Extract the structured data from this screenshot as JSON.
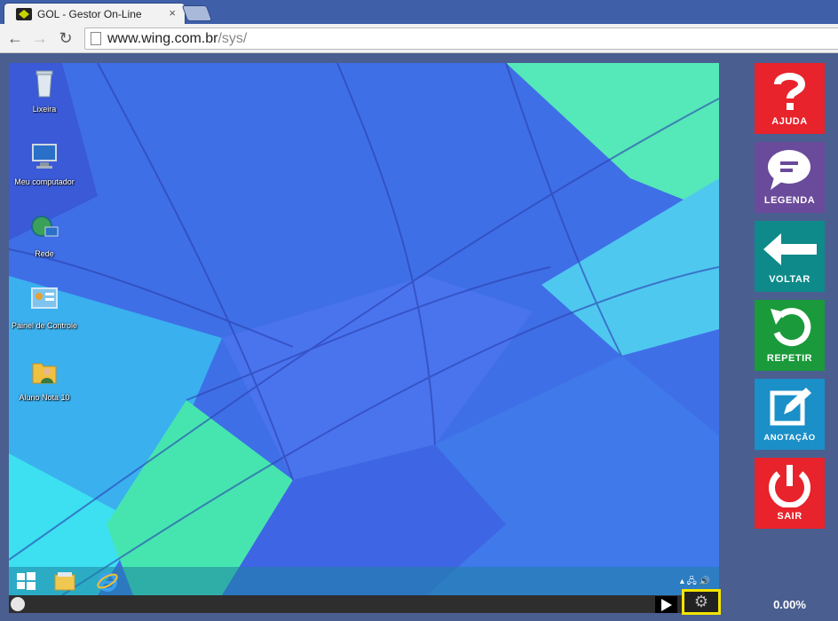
{
  "browser": {
    "tab_title": "GOL - Gestor On-Line",
    "close_glyph": "×",
    "url_host": "www.wing.com.br",
    "url_path": "/sys/",
    "back_glyph": "←",
    "forward_glyph": "→",
    "reload_glyph": "↻"
  },
  "desktop": {
    "icons": [
      {
        "label": "Lixeira",
        "icon": "recycle-bin-icon"
      },
      {
        "label": "Meu computador",
        "icon": "computer-icon"
      },
      {
        "label": "Rede",
        "icon": "network-icon"
      },
      {
        "label": "Painel de Controle",
        "icon": "control-panel-icon"
      },
      {
        "label": "Aluno Nota 10",
        "icon": "user-folder-icon"
      }
    ],
    "taskbar": {
      "items": [
        "start-icon",
        "file-explorer-icon",
        "internet-explorer-icon"
      ],
      "tray": "▴  🖧  🔊"
    }
  },
  "player": {
    "progress": "0.00%",
    "gear_glyph": "⚙"
  },
  "sidebar": {
    "buttons": [
      {
        "label": "AJUDA",
        "color": "#e8232b",
        "icon": "question-icon"
      },
      {
        "label": "LEGENDA",
        "color": "#6a4a9a",
        "icon": "chat-bubble-icon"
      },
      {
        "label": "VOLTAR",
        "color": "#0e8a8a",
        "icon": "arrow-left-icon"
      },
      {
        "label": "REPETIR",
        "color": "#1a9a3a",
        "icon": "repeat-icon"
      },
      {
        "label": "ANOTAÇÃO",
        "color": "#1a8fc8",
        "icon": "note-edit-icon"
      },
      {
        "label": "SAIR",
        "color": "#e8232b",
        "icon": "power-icon"
      }
    ]
  }
}
